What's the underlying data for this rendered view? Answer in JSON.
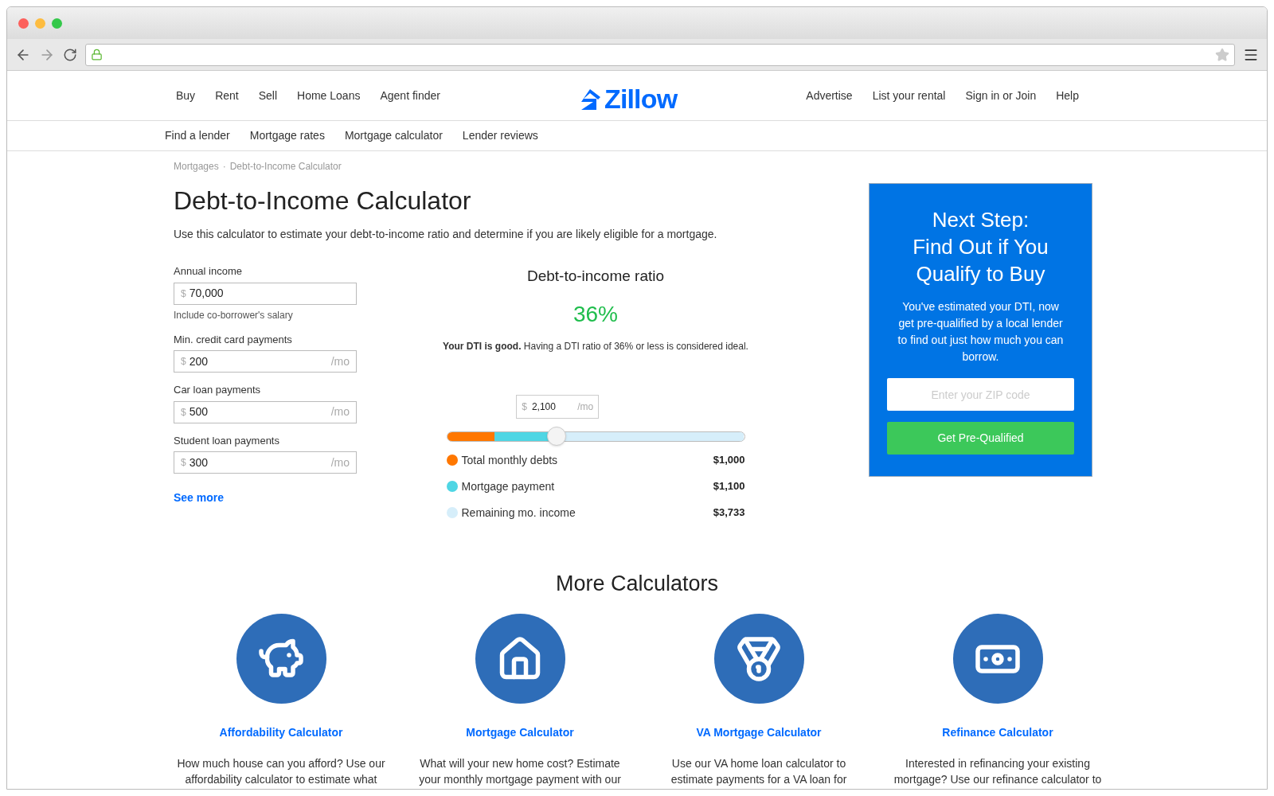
{
  "browser": {
    "secure": true
  },
  "nav": {
    "left": [
      "Buy",
      "Rent",
      "Sell",
      "Home Loans",
      "Agent finder"
    ],
    "logo": "Zillow",
    "right": [
      "Advertise",
      "List your rental",
      "Sign in or Join",
      "Help"
    ]
  },
  "subnav": [
    "Find a lender",
    "Mortgage rates",
    "Mortgage calculator",
    "Lender reviews"
  ],
  "breadcrumb": {
    "items": [
      "Mortgages",
      "Debt-to-Income Calculator"
    ],
    "separator": "·"
  },
  "title": "Debt-to-Income Calculator",
  "intro": "Use this calculator to estimate your debt-to-income ratio and determine if you are likely eligible for a mortgage.",
  "fields": [
    {
      "label": "Annual income",
      "currency": "$",
      "value": "70,000",
      "hint": "Include co-borrower's salary"
    },
    {
      "label": "Min. credit card payments",
      "currency": "$",
      "value": "200",
      "unit": "/mo"
    },
    {
      "label": "Car loan payments",
      "currency": "$",
      "value": "500",
      "unit": "/mo"
    },
    {
      "label": "Student loan payments",
      "currency": "$",
      "value": "300",
      "unit": "/mo"
    }
  ],
  "see_more": "See more",
  "result": {
    "heading": "Debt-to-income ratio",
    "ratio": "36%",
    "message": "**Your DTI is good.** Having a DTI ratio of 36% or less is considered ideal.",
    "slider": {
      "currency": "$",
      "value": "2,100",
      "unit": "/mo",
      "level": 0.37
    },
    "legend": [
      {
        "label": "Total monthly debts",
        "amount": "$1,000",
        "color": "#ff7700",
        "level": 0.16
      },
      {
        "label": "Mortgage payment",
        "amount": "$1,100",
        "color": "#4fd6e4",
        "level": 0.21
      },
      {
        "label": "Remaining mo. income",
        "amount": "$3,733",
        "color": "#d6eefa",
        "level": 0.63
      }
    ]
  },
  "promo": {
    "title": "Next Step:\nFind Out if You\nQualify to Buy",
    "text": "You've estimated your DTI, now get pre-qualified by a local lender to find out just how much you can borrow.",
    "placeholder": "Enter your ZIP code",
    "button": "Get Pre-Qualified"
  },
  "more": {
    "heading": "More Calculators",
    "items": [
      {
        "kind": "piggy",
        "title": "Affordability Calculator",
        "text": "How much house can you afford? Use our\naffordability calculator to estimate what"
      },
      {
        "kind": "house",
        "title": "Mortgage Calculator",
        "text": "What will your new home cost? Estimate\nyour monthly mortgage payment with our"
      },
      {
        "kind": "medal",
        "title": "VA Mortgage Calculator",
        "text": "Use our VA home loan calculator to\nestimate payments for a VA loan for"
      },
      {
        "kind": "money",
        "title": "Refinance Calculator",
        "text": "Interested in refinancing your existing\nmortgage? Use our refinance calculator to"
      }
    ]
  }
}
